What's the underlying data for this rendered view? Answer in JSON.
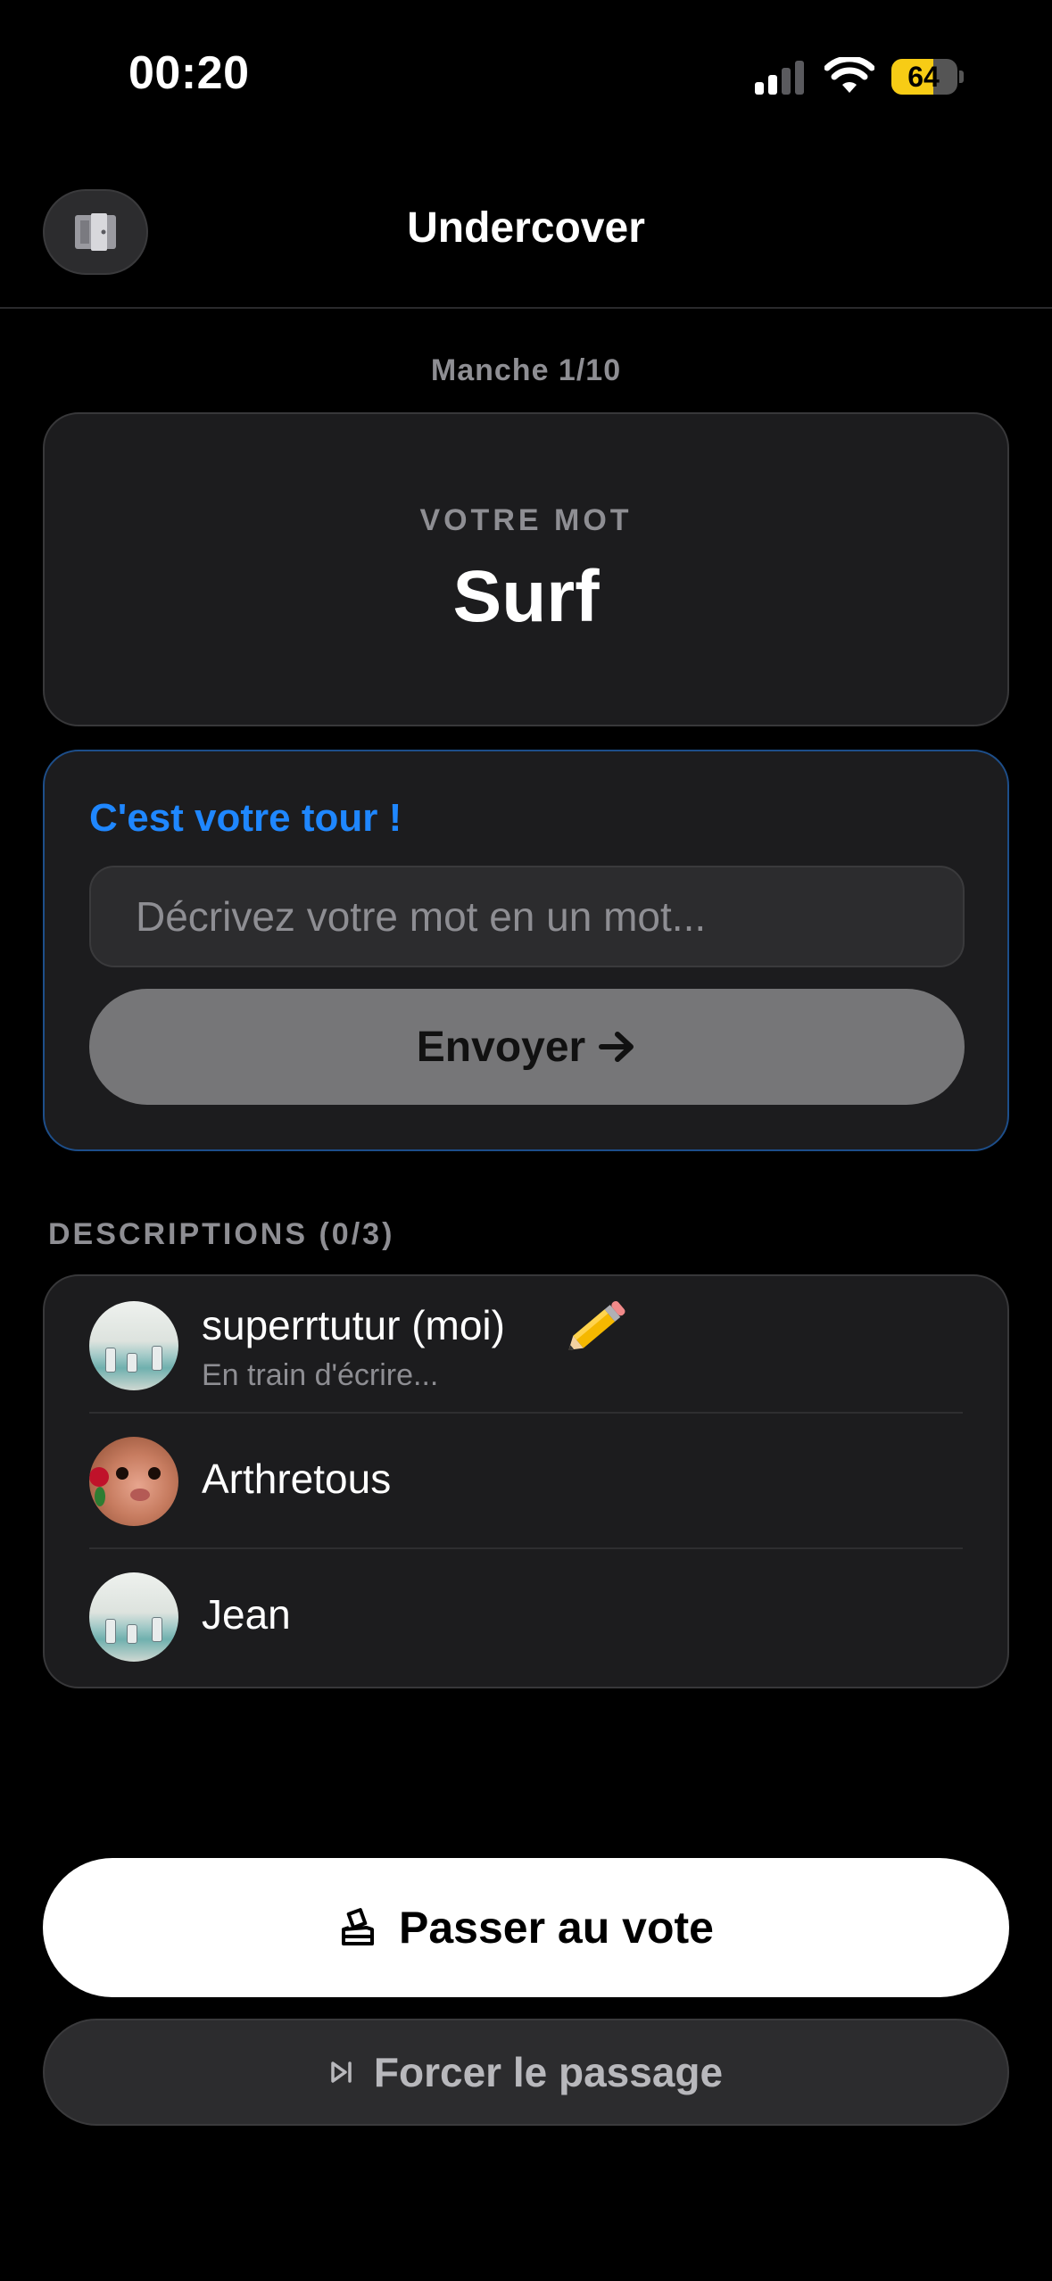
{
  "status_bar": {
    "time": "00:20",
    "battery_level": "64",
    "battery_fraction": 0.64,
    "signal_bars_active": 2,
    "signal_bars_total": 4,
    "icons": [
      "signal-icon",
      "wifi-icon",
      "battery-icon"
    ]
  },
  "header": {
    "title": "Undercover",
    "exit_icon": "door-exit-icon"
  },
  "round": {
    "label": "Manche 1/10"
  },
  "word_card": {
    "label": "VOTRE MOT",
    "word": "Surf"
  },
  "turn": {
    "title": "C'est votre tour !",
    "input_placeholder": "Décrivez votre mot en un mot...",
    "input_value": "",
    "send_label": "Envoyer",
    "send_icon": "arrow-right-icon"
  },
  "descriptions": {
    "header": "DESCRIPTIONS (0/3)",
    "players": [
      {
        "name": "superrtutur (moi)",
        "status": "En train d'écrire...",
        "icon": "pencil-icon"
      },
      {
        "name": "Arthretous",
        "status": ""
      },
      {
        "name": "Jean",
        "status": ""
      }
    ]
  },
  "actions": {
    "vote_label": "Passer au vote",
    "vote_icon": "ballot-box-icon",
    "force_label": "Forcer le passage",
    "force_icon": "skip-forward-icon"
  },
  "colors": {
    "background": "#000000",
    "card": "#1c1c1e",
    "accent_blue": "#1f87ff",
    "battery_yellow": "#f7cc15",
    "muted_text": "#8e8e93"
  }
}
